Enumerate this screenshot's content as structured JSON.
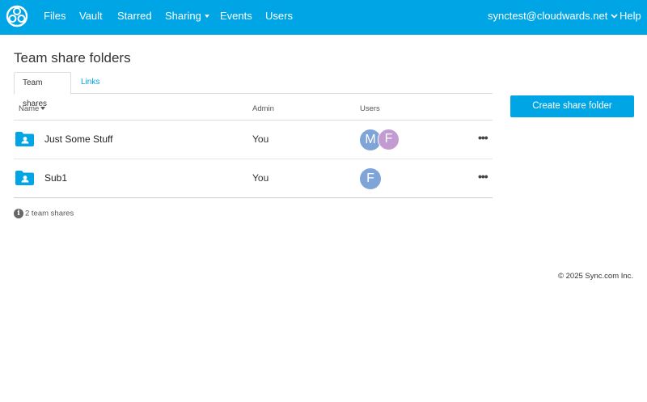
{
  "header": {
    "nav": [
      "Files",
      "Vault",
      "Starred",
      "Sharing",
      "Events",
      "Users"
    ],
    "account": "synctest@cloudwards.net",
    "help": "Help"
  },
  "page": {
    "title": "Team share folders"
  },
  "tabs": [
    "Team shares",
    "Links"
  ],
  "table": {
    "columns": [
      "Name",
      "Admin",
      "Users"
    ],
    "rows": [
      {
        "name": "Just Some Stuff",
        "admin": "You",
        "users": [
          "M",
          "F"
        ]
      },
      {
        "name": "Sub1",
        "admin": "You",
        "users": [
          "F"
        ]
      }
    ],
    "more_label": "•••"
  },
  "summary": {
    "info_glyph": "i",
    "count_text": "2 team shares"
  },
  "actions": {
    "create_button": "Create share folder"
  },
  "footer": {
    "copyright": "© 2025 Sync.com Inc."
  },
  "colors": {
    "brand": "#00a5e6",
    "avatar_blue": "#7fa4d8",
    "avatar_purple": "#c39bd3"
  }
}
